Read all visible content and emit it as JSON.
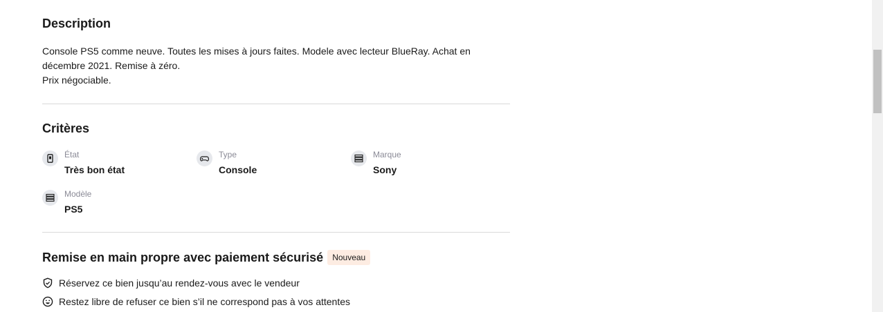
{
  "description": {
    "title": "Description",
    "text": "Console PS5 comme neuve. Toutes les mises à jours faites. Modele avec lecteur BlueRay. Achat en\ndécembre 2021. Remise à zéro.\nPrix négociable."
  },
  "criteria": {
    "title": "Critères",
    "items": [
      {
        "label": "État",
        "value": "Très bon état",
        "icon": "phone-condition-icon"
      },
      {
        "label": "Type",
        "value": "Console",
        "icon": "gamepad-icon"
      },
      {
        "label": "Marque",
        "value": "Sony",
        "icon": "list-icon"
      },
      {
        "label": "Modèle",
        "value": "PS5",
        "icon": "list-icon"
      }
    ]
  },
  "remise": {
    "title": "Remise en main propre avec paiement sécurisé",
    "badge": "Nouveau",
    "benefits": [
      {
        "text": "Réservez ce bien jusqu’au rendez-vous avec le vendeur",
        "icon": "shield-icon"
      },
      {
        "text": "Restez libre de refuser ce bien s’il ne correspond pas à vos attentes",
        "icon": "smiley-icon"
      }
    ]
  }
}
